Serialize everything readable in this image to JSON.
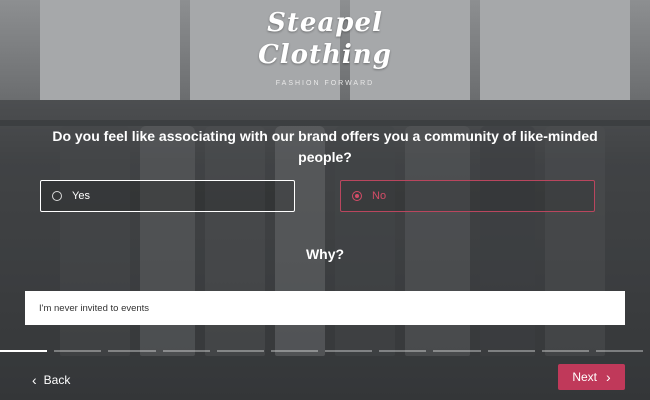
{
  "brand": {
    "name_line1": "Steapel",
    "name_line2": "Clothing",
    "tagline": "FASHION FORWARD"
  },
  "survey": {
    "question": "Do you feel like associating with our brand offers you a community of like-minded people?",
    "options": [
      {
        "label": "Yes",
        "selected": false
      },
      {
        "label": "No",
        "selected": true
      }
    ],
    "followup_label": "Why?",
    "followup_value": "I'm never invited to events",
    "progress": {
      "current_step": 1,
      "total_steps": 12
    }
  },
  "nav": {
    "back_label": "Back",
    "next_label": "Next"
  },
  "icons": {
    "back": "chevron-left-icon",
    "next": "chevron-right-icon"
  },
  "colors": {
    "accent": "#c0395a",
    "selected_text": "#d44c67"
  }
}
